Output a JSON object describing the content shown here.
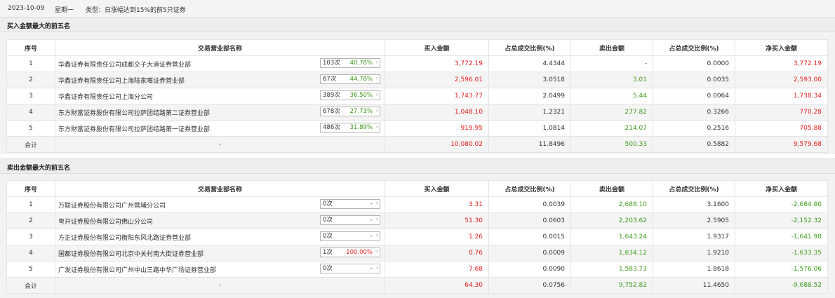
{
  "topbar": {
    "date": "2023-10-09",
    "weekday": "星期一",
    "type_label": "类型：日涨幅达到15%的前5只证券"
  },
  "columns": [
    "序号",
    "交易营业部名称",
    "买入金额",
    "占总成交比例(%)",
    "卖出金额",
    "占总成交比例(%)",
    "净买入金额"
  ],
  "colors": {
    "positive": "#e01e1e",
    "negative": "#3d9a1c"
  },
  "buy_section": {
    "title": "买入金额最大的前五名",
    "rows": [
      {
        "idx": "1",
        "name": "华鑫证券有限责任公司成都交子大道证券营业部",
        "count": "103次",
        "pct": "40.78%",
        "buy": "3,772.19",
        "buy_ratio": "4.4344",
        "sell": "-",
        "sell_ratio": "0.0000",
        "net": "3,772.19"
      },
      {
        "idx": "2",
        "name": "华鑫证券有限责任公司上海陆家嘴证券营业部",
        "count": "67次",
        "pct": "44.78%",
        "buy": "2,596.01",
        "buy_ratio": "3.0518",
        "sell": "3.01",
        "sell_ratio": "0.0035",
        "net": "2,593.00"
      },
      {
        "idx": "3",
        "name": "华鑫证券有限责任公司上海分公司",
        "count": "389次",
        "pct": "36.50%",
        "buy": "1,743.77",
        "buy_ratio": "2.0499",
        "sell": "5.44",
        "sell_ratio": "0.0064",
        "net": "1,738.34"
      },
      {
        "idx": "4",
        "name": "东方财富证券股份有限公司拉萨团结路第二证券营业部",
        "count": "678次",
        "pct": "27.73%",
        "buy": "1,048.10",
        "buy_ratio": "1.2321",
        "sell": "277.82",
        "sell_ratio": "0.3266",
        "net": "770.28"
      },
      {
        "idx": "5",
        "name": "东方财富证券股份有限公司拉萨团结路第一证券营业部",
        "count": "486次",
        "pct": "31.89%",
        "buy": "919.95",
        "buy_ratio": "1.0814",
        "sell": "214.07",
        "sell_ratio": "0.2516",
        "net": "705.88"
      }
    ],
    "total": {
      "label": "合计",
      "name": "-",
      "buy": "10,080.02",
      "buy_ratio": "11.8496",
      "sell": "500.33",
      "sell_ratio": "0.5882",
      "net": "9,579.68"
    }
  },
  "sell_section": {
    "title": "卖出金额最大的前五名",
    "rows": [
      {
        "idx": "1",
        "name": "万联证券股份有限公司广州营埔分公司",
        "count": "0次",
        "pct": "-",
        "buy": "3.31",
        "buy_ratio": "0.0039",
        "sell": "2,688.10",
        "sell_ratio": "3.1600",
        "net": "-2,684.80"
      },
      {
        "idx": "2",
        "name": "粤开证券股份有限公司佛山分公司",
        "count": "0次",
        "pct": "-",
        "buy": "51.30",
        "buy_ratio": "0.0603",
        "sell": "2,203.62",
        "sell_ratio": "2.5905",
        "net": "-2,152.32"
      },
      {
        "idx": "3",
        "name": "方正证券股份有限公司衡阳东风北路证券营业部",
        "count": "0次",
        "pct": "-",
        "buy": "1.26",
        "buy_ratio": "0.0015",
        "sell": "1,643.24",
        "sell_ratio": "1.9317",
        "net": "-1,641.98"
      },
      {
        "idx": "4",
        "name": "国都证券股份有限公司北京中关村南大街证券营业部",
        "count": "1次",
        "pct": "100.00%",
        "buy": "0.76",
        "buy_ratio": "0.0009",
        "sell": "1,634.12",
        "sell_ratio": "1.9210",
        "net": "-1,633.35"
      },
      {
        "idx": "5",
        "name": "广发证券股份有限公司广州中山三路中华广场证券营业部",
        "count": "0次",
        "pct": "-",
        "buy": "7.68",
        "buy_ratio": "0.0090",
        "sell": "1,583.73",
        "sell_ratio": "1.8618",
        "net": "-1,576.06"
      }
    ],
    "total": {
      "label": "合计",
      "name": "-",
      "buy": "64.30",
      "buy_ratio": "0.0756",
      "sell": "9,752.82",
      "sell_ratio": "11.4650",
      "net": "-9,688.52"
    }
  }
}
